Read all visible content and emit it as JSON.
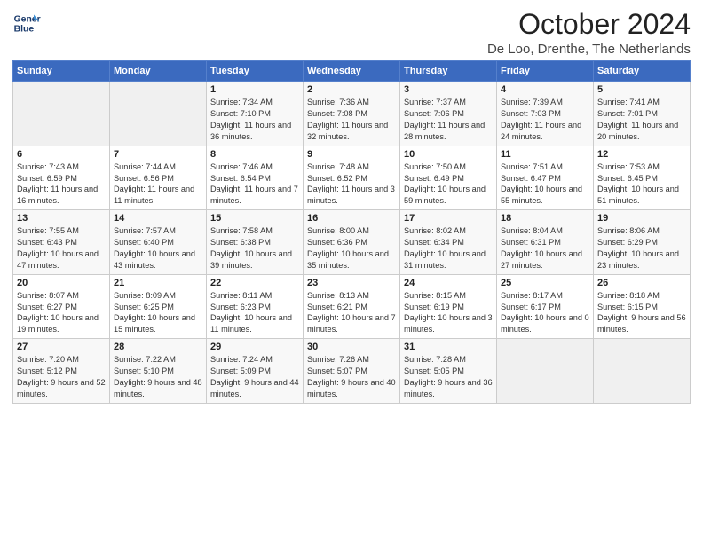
{
  "header": {
    "logo_line1": "General",
    "logo_line2": "Blue",
    "month": "October 2024",
    "location": "De Loo, Drenthe, The Netherlands"
  },
  "days_of_week": [
    "Sunday",
    "Monday",
    "Tuesday",
    "Wednesday",
    "Thursday",
    "Friday",
    "Saturday"
  ],
  "weeks": [
    [
      {
        "day": "",
        "empty": true
      },
      {
        "day": "",
        "empty": true
      },
      {
        "day": "1",
        "sunrise": "Sunrise: 7:34 AM",
        "sunset": "Sunset: 7:10 PM",
        "daylight": "Daylight: 11 hours and 36 minutes."
      },
      {
        "day": "2",
        "sunrise": "Sunrise: 7:36 AM",
        "sunset": "Sunset: 7:08 PM",
        "daylight": "Daylight: 11 hours and 32 minutes."
      },
      {
        "day": "3",
        "sunrise": "Sunrise: 7:37 AM",
        "sunset": "Sunset: 7:06 PM",
        "daylight": "Daylight: 11 hours and 28 minutes."
      },
      {
        "day": "4",
        "sunrise": "Sunrise: 7:39 AM",
        "sunset": "Sunset: 7:03 PM",
        "daylight": "Daylight: 11 hours and 24 minutes."
      },
      {
        "day": "5",
        "sunrise": "Sunrise: 7:41 AM",
        "sunset": "Sunset: 7:01 PM",
        "daylight": "Daylight: 11 hours and 20 minutes."
      }
    ],
    [
      {
        "day": "6",
        "sunrise": "Sunrise: 7:43 AM",
        "sunset": "Sunset: 6:59 PM",
        "daylight": "Daylight: 11 hours and 16 minutes."
      },
      {
        "day": "7",
        "sunrise": "Sunrise: 7:44 AM",
        "sunset": "Sunset: 6:56 PM",
        "daylight": "Daylight: 11 hours and 11 minutes."
      },
      {
        "day": "8",
        "sunrise": "Sunrise: 7:46 AM",
        "sunset": "Sunset: 6:54 PM",
        "daylight": "Daylight: 11 hours and 7 minutes."
      },
      {
        "day": "9",
        "sunrise": "Sunrise: 7:48 AM",
        "sunset": "Sunset: 6:52 PM",
        "daylight": "Daylight: 11 hours and 3 minutes."
      },
      {
        "day": "10",
        "sunrise": "Sunrise: 7:50 AM",
        "sunset": "Sunset: 6:49 PM",
        "daylight": "Daylight: 10 hours and 59 minutes."
      },
      {
        "day": "11",
        "sunrise": "Sunrise: 7:51 AM",
        "sunset": "Sunset: 6:47 PM",
        "daylight": "Daylight: 10 hours and 55 minutes."
      },
      {
        "day": "12",
        "sunrise": "Sunrise: 7:53 AM",
        "sunset": "Sunset: 6:45 PM",
        "daylight": "Daylight: 10 hours and 51 minutes."
      }
    ],
    [
      {
        "day": "13",
        "sunrise": "Sunrise: 7:55 AM",
        "sunset": "Sunset: 6:43 PM",
        "daylight": "Daylight: 10 hours and 47 minutes."
      },
      {
        "day": "14",
        "sunrise": "Sunrise: 7:57 AM",
        "sunset": "Sunset: 6:40 PM",
        "daylight": "Daylight: 10 hours and 43 minutes."
      },
      {
        "day": "15",
        "sunrise": "Sunrise: 7:58 AM",
        "sunset": "Sunset: 6:38 PM",
        "daylight": "Daylight: 10 hours and 39 minutes."
      },
      {
        "day": "16",
        "sunrise": "Sunrise: 8:00 AM",
        "sunset": "Sunset: 6:36 PM",
        "daylight": "Daylight: 10 hours and 35 minutes."
      },
      {
        "day": "17",
        "sunrise": "Sunrise: 8:02 AM",
        "sunset": "Sunset: 6:34 PM",
        "daylight": "Daylight: 10 hours and 31 minutes."
      },
      {
        "day": "18",
        "sunrise": "Sunrise: 8:04 AM",
        "sunset": "Sunset: 6:31 PM",
        "daylight": "Daylight: 10 hours and 27 minutes."
      },
      {
        "day": "19",
        "sunrise": "Sunrise: 8:06 AM",
        "sunset": "Sunset: 6:29 PM",
        "daylight": "Daylight: 10 hours and 23 minutes."
      }
    ],
    [
      {
        "day": "20",
        "sunrise": "Sunrise: 8:07 AM",
        "sunset": "Sunset: 6:27 PM",
        "daylight": "Daylight: 10 hours and 19 minutes."
      },
      {
        "day": "21",
        "sunrise": "Sunrise: 8:09 AM",
        "sunset": "Sunset: 6:25 PM",
        "daylight": "Daylight: 10 hours and 15 minutes."
      },
      {
        "day": "22",
        "sunrise": "Sunrise: 8:11 AM",
        "sunset": "Sunset: 6:23 PM",
        "daylight": "Daylight: 10 hours and 11 minutes."
      },
      {
        "day": "23",
        "sunrise": "Sunrise: 8:13 AM",
        "sunset": "Sunset: 6:21 PM",
        "daylight": "Daylight: 10 hours and 7 minutes."
      },
      {
        "day": "24",
        "sunrise": "Sunrise: 8:15 AM",
        "sunset": "Sunset: 6:19 PM",
        "daylight": "Daylight: 10 hours and 3 minutes."
      },
      {
        "day": "25",
        "sunrise": "Sunrise: 8:17 AM",
        "sunset": "Sunset: 6:17 PM",
        "daylight": "Daylight: 10 hours and 0 minutes."
      },
      {
        "day": "26",
        "sunrise": "Sunrise: 8:18 AM",
        "sunset": "Sunset: 6:15 PM",
        "daylight": "Daylight: 9 hours and 56 minutes."
      }
    ],
    [
      {
        "day": "27",
        "sunrise": "Sunrise: 7:20 AM",
        "sunset": "Sunset: 5:12 PM",
        "daylight": "Daylight: 9 hours and 52 minutes."
      },
      {
        "day": "28",
        "sunrise": "Sunrise: 7:22 AM",
        "sunset": "Sunset: 5:10 PM",
        "daylight": "Daylight: 9 hours and 48 minutes."
      },
      {
        "day": "29",
        "sunrise": "Sunrise: 7:24 AM",
        "sunset": "Sunset: 5:09 PM",
        "daylight": "Daylight: 9 hours and 44 minutes."
      },
      {
        "day": "30",
        "sunrise": "Sunrise: 7:26 AM",
        "sunset": "Sunset: 5:07 PM",
        "daylight": "Daylight: 9 hours and 40 minutes."
      },
      {
        "day": "31",
        "sunrise": "Sunrise: 7:28 AM",
        "sunset": "Sunset: 5:05 PM",
        "daylight": "Daylight: 9 hours and 36 minutes."
      },
      {
        "day": "",
        "empty": true
      },
      {
        "day": "",
        "empty": true
      }
    ]
  ]
}
